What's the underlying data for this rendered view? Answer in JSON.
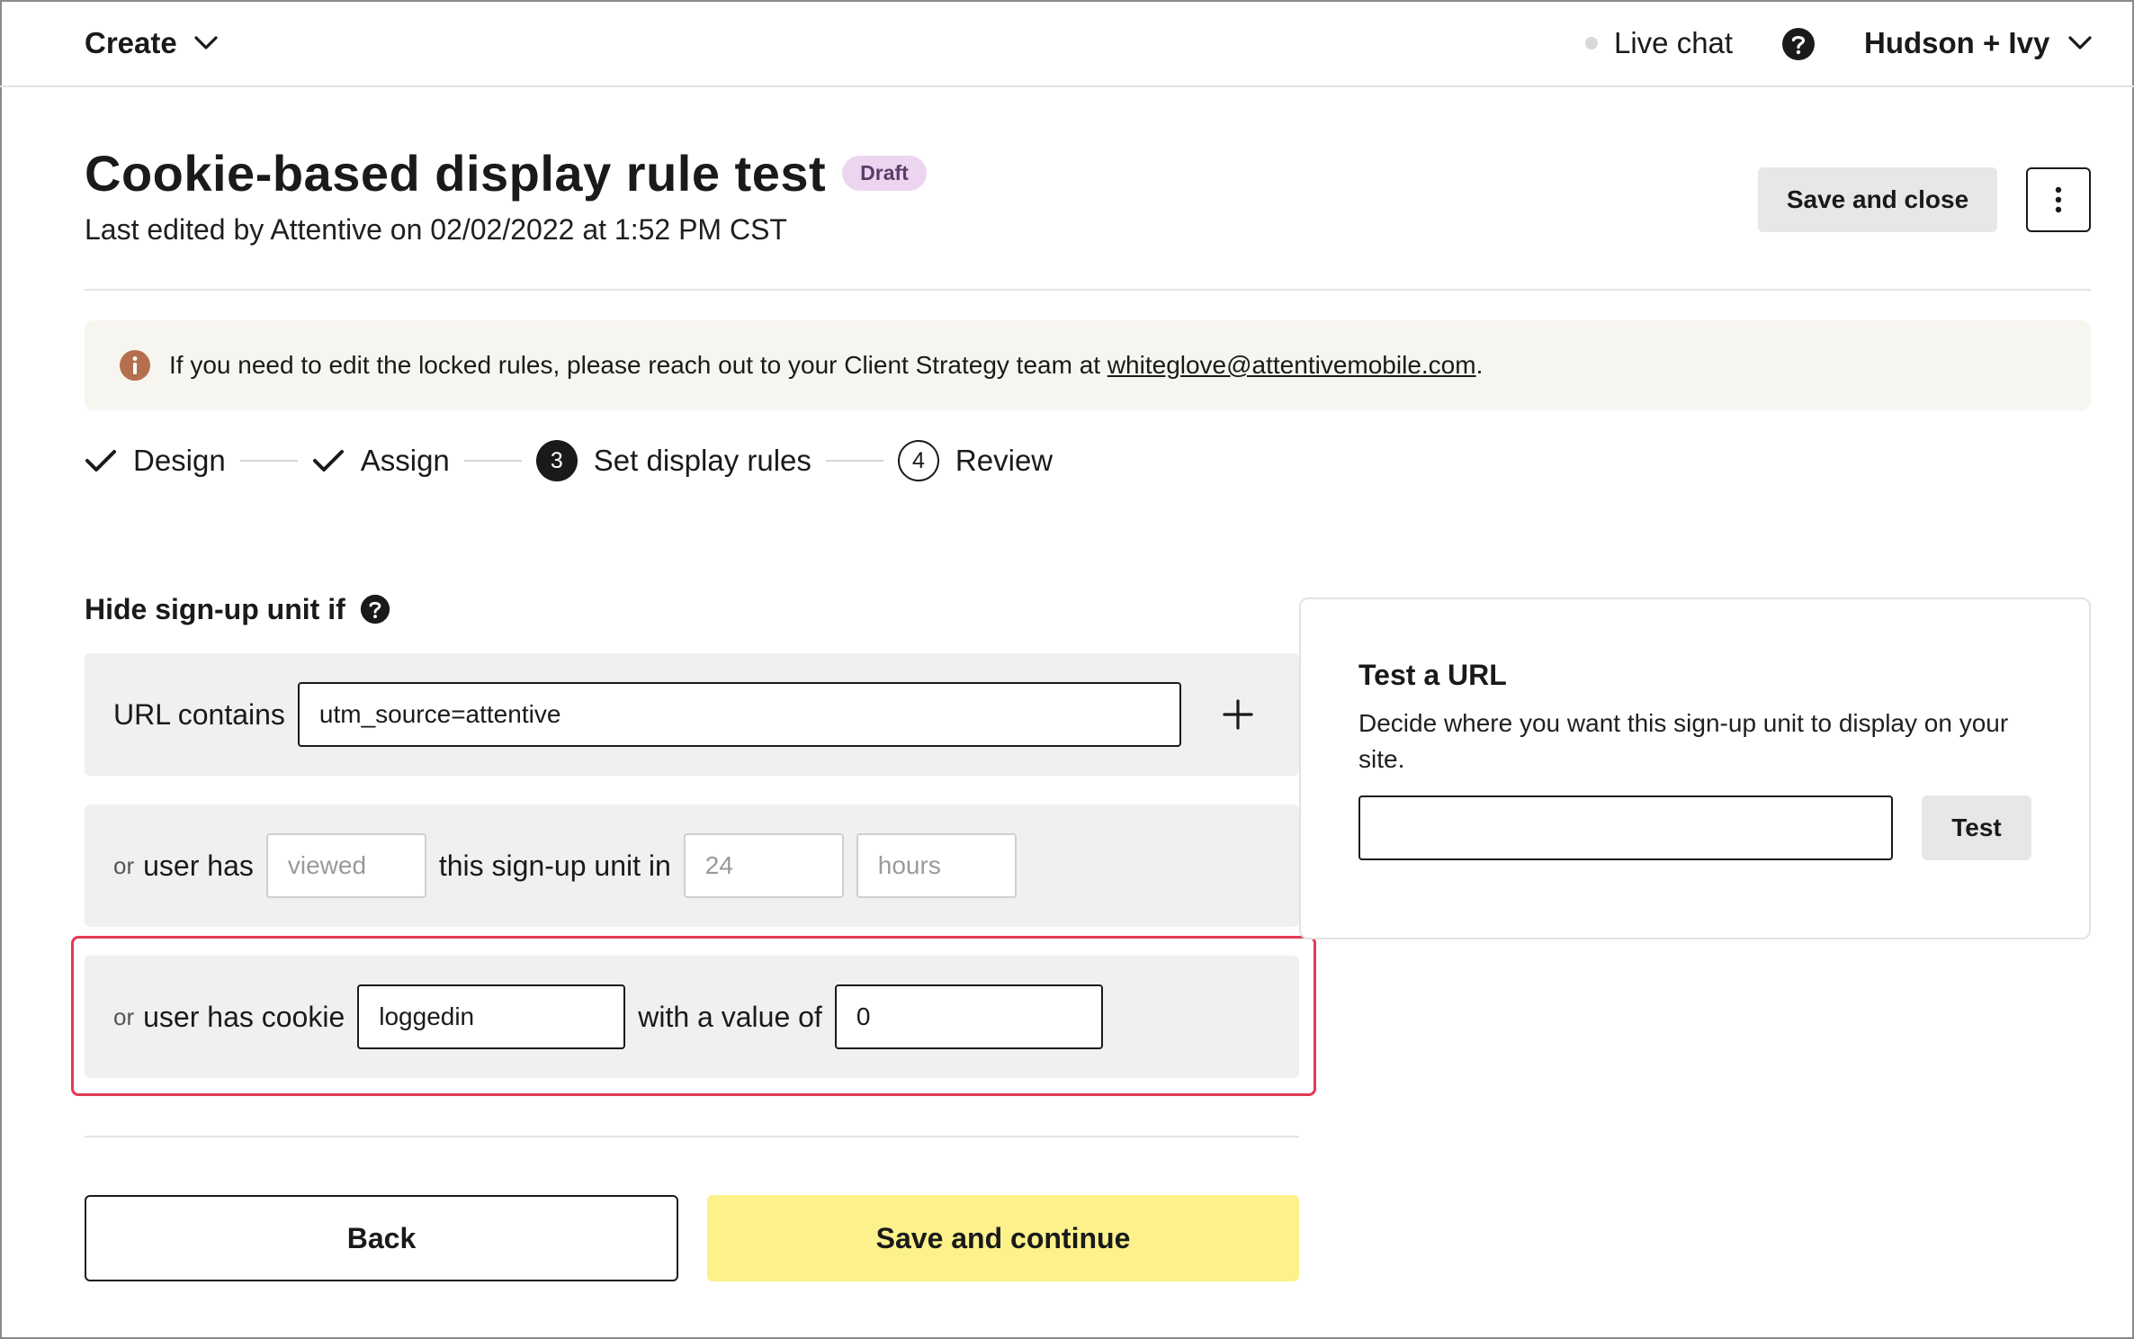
{
  "topbar": {
    "create_label": "Create",
    "live_chat_label": "Live chat",
    "account_name": "Hudson + Ivy"
  },
  "header": {
    "title": "Cookie-based display rule test",
    "status_badge": "Draft",
    "last_edited": "Last edited by Attentive on 02/02/2022 at 1:52 PM CST",
    "save_close_label": "Save and close"
  },
  "banner": {
    "text": "If you need to edit the locked rules, please reach out to your Client Strategy team at ",
    "email": "whiteglove@attentivemobile.com",
    "suffix": "."
  },
  "stepper": {
    "steps": [
      {
        "label": "Design",
        "state": "done"
      },
      {
        "label": "Assign",
        "state": "done"
      },
      {
        "label": "Set display rules",
        "number": "3",
        "state": "active"
      },
      {
        "label": "Review",
        "number": "4",
        "state": "pending"
      }
    ]
  },
  "rules": {
    "heading": "Hide sign-up unit if",
    "url_rule": {
      "label": "URL contains",
      "value": "utm_source=attentive"
    },
    "view_rule": {
      "or": "or",
      "label_a": "user has",
      "action_placeholder": "viewed",
      "label_b": "this sign-up unit in",
      "count_placeholder": "24",
      "unit_placeholder": "hours"
    },
    "cookie_rule": {
      "or": "or",
      "label_a": "user has cookie",
      "cookie_name": "loggedin",
      "label_b": "with a value of",
      "cookie_value": "0"
    }
  },
  "footer": {
    "back_label": "Back",
    "continue_label": "Save and continue"
  },
  "test_url": {
    "title": "Test a URL",
    "description": "Decide where you want this sign-up unit to display on your site.",
    "input_value": "",
    "test_label": "Test"
  },
  "colors": {
    "accent_yellow": "#fcf18b",
    "badge_bg": "#ecd6ef",
    "highlight_red": "#e23a55",
    "info_icon": "#b4704e",
    "row_bg": "#eff0f0"
  }
}
